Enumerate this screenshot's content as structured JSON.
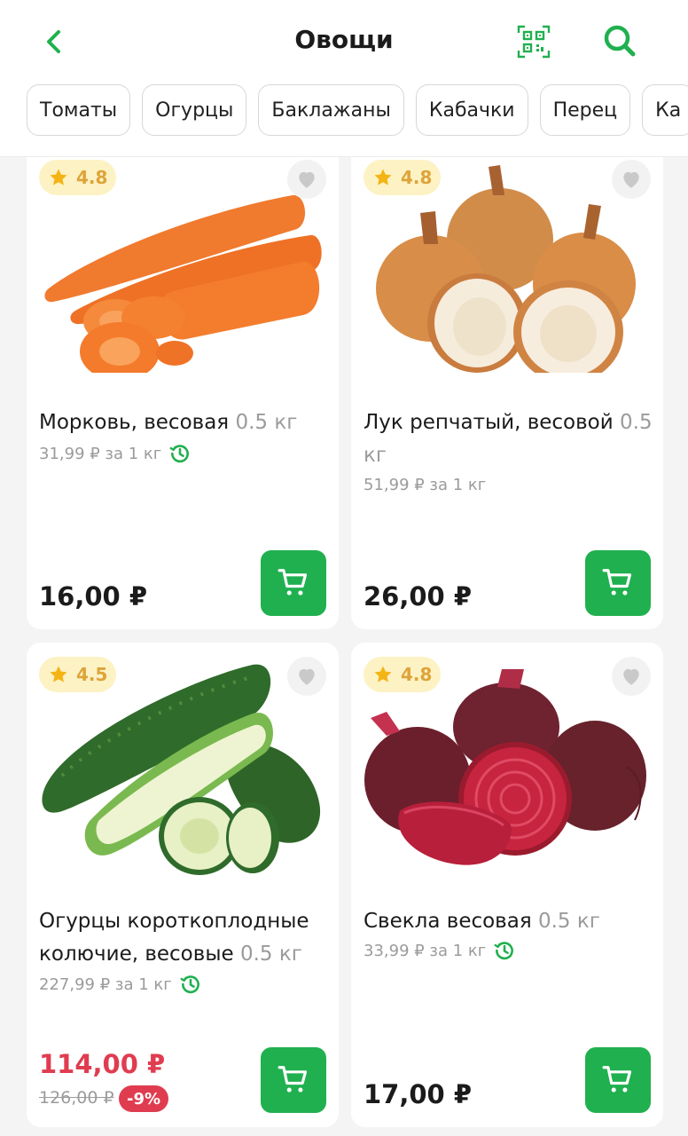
{
  "header": {
    "title": "Овощи"
  },
  "chips": [
    "Томаты",
    "Огурцы",
    "Баклажаны",
    "Кабачки",
    "Перец",
    "Ка"
  ],
  "products": [
    {
      "rating": "4.8",
      "name": "Морковь, весовая",
      "weight": "0.5 кг",
      "unit_price": "31,99 ₽ за 1 кг",
      "price": "16,00 ₽"
    },
    {
      "rating": "4.8",
      "name": "Лук репчатый, весовой",
      "weight": "0.5 кг",
      "unit_price": "51,99 ₽ за 1 кг",
      "price": "26,00 ₽"
    },
    {
      "rating": "4.5",
      "name": "Огурцы короткоплодные колючие, весовые",
      "weight": "0.5 кг",
      "unit_price": "227,99 ₽ за 1 кг",
      "price": "114,00 ₽",
      "old_price": "126,00 ₽",
      "discount": "-9%"
    },
    {
      "rating": "4.8",
      "name": "Свекла весовая",
      "weight": "0.5 кг",
      "unit_price": "33,99 ₽ за 1 кг",
      "price": "17,00 ₽"
    }
  ],
  "colors": {
    "accent": "#20b04f",
    "sale": "#e03c50",
    "rating_bg": "#fdf2c4",
    "rating_text": "#dea43a"
  },
  "icons": [
    "back-arrow-icon",
    "qr-code-icon",
    "search-icon",
    "star-icon",
    "heart-icon",
    "history-clock-icon",
    "cart-icon"
  ]
}
